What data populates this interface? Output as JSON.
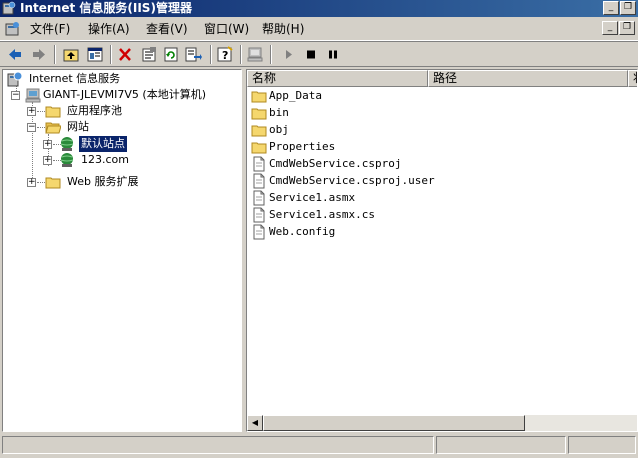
{
  "window": {
    "title": "Internet 信息服务(IIS)管理器",
    "minimize_glyph": "_",
    "restore_glyph": "❐",
    "close_glyph": "✕"
  },
  "menu": {
    "items": [
      {
        "label": "文件(F)"
      },
      {
        "label": "操作(A)"
      },
      {
        "label": "查看(V)"
      },
      {
        "label": "窗口(W)"
      },
      {
        "label": "帮助(H)"
      }
    ]
  },
  "toolbar": {
    "icons": [
      "back-arrow-icon",
      "forward-arrow-icon",
      "up-level-icon",
      "show-hide-tree-icon",
      "delete-icon",
      "properties-icon",
      "refresh-icon",
      "export-list-icon",
      "help-icon",
      "computer-icon",
      "start-icon",
      "stop-icon",
      "pause-icon"
    ]
  },
  "tree": {
    "root": "Internet 信息服务",
    "server": "GIANT-JLEVMI7V5 (本地计算机)",
    "app_pools": "应用程序池",
    "websites": "网站",
    "default_site": "默认站点",
    "site2": "123.com",
    "web_ext": "Web 服务扩展"
  },
  "list": {
    "columns": [
      "名称",
      "路径",
      "状"
    ],
    "files": [
      {
        "name": "App_Data",
        "type": "folder"
      },
      {
        "name": "bin",
        "type": "folder"
      },
      {
        "name": "obj",
        "type": "folder"
      },
      {
        "name": "Properties",
        "type": "folder"
      },
      {
        "name": "CmdWebService.csproj",
        "type": "file"
      },
      {
        "name": "CmdWebService.csproj.user",
        "type": "file"
      },
      {
        "name": "Service1.asmx",
        "type": "file"
      },
      {
        "name": "Service1.asmx.cs",
        "type": "file"
      },
      {
        "name": "Web.config",
        "type": "file"
      }
    ]
  },
  "colors": {
    "titlebar": "#0a246a",
    "face": "#d4d0c8",
    "selection": "#0a246a",
    "folder": "#f5d76e"
  }
}
